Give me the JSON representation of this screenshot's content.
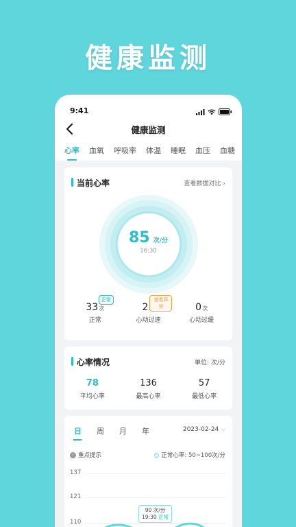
{
  "promo": {
    "title": "健康监测"
  },
  "status_bar": {
    "time": "9:41"
  },
  "nav": {
    "title": "健康监测"
  },
  "tabs": [
    {
      "label": "心率",
      "active": true
    },
    {
      "label": "血氧"
    },
    {
      "label": "呼吸率"
    },
    {
      "label": "体温"
    },
    {
      "label": "睡眠"
    },
    {
      "label": "血压"
    },
    {
      "label": "血糖"
    }
  ],
  "current_hr": {
    "title": "当前心率",
    "link": "查看数据对比",
    "value": "85",
    "unit": "次/分",
    "time": "16:30",
    "stats": [
      {
        "num": "33",
        "unit": "次",
        "label": "正常",
        "badge": "正常"
      },
      {
        "num": "2",
        "unit": "次",
        "label": "心动过速",
        "badge": "查看异常"
      },
      {
        "num": "0",
        "unit": "次",
        "label": "心动过缓"
      }
    ]
  },
  "hr_summary": {
    "title": "心率情况",
    "unit_label": "单位: 次/分",
    "items": [
      {
        "value": "78",
        "label": "平均心率"
      },
      {
        "value": "136",
        "label": "最高心率"
      },
      {
        "value": "57",
        "label": "最低心率"
      }
    ]
  },
  "chart_panel": {
    "periods": [
      "日",
      "周",
      "月",
      "年"
    ],
    "active_period": "日",
    "date": "2023-02-24",
    "tip": "重点提示",
    "legend": "正常心率: 50~100次/分",
    "y_ticks": [
      "137",
      "121",
      "110"
    ],
    "tooltip": {
      "value": "90 次/分",
      "time": "19:30",
      "status": "正常"
    }
  },
  "colors": {
    "accent": "#2bbdc8",
    "background": "#5fd6dc",
    "warning": "#f0a04b"
  }
}
